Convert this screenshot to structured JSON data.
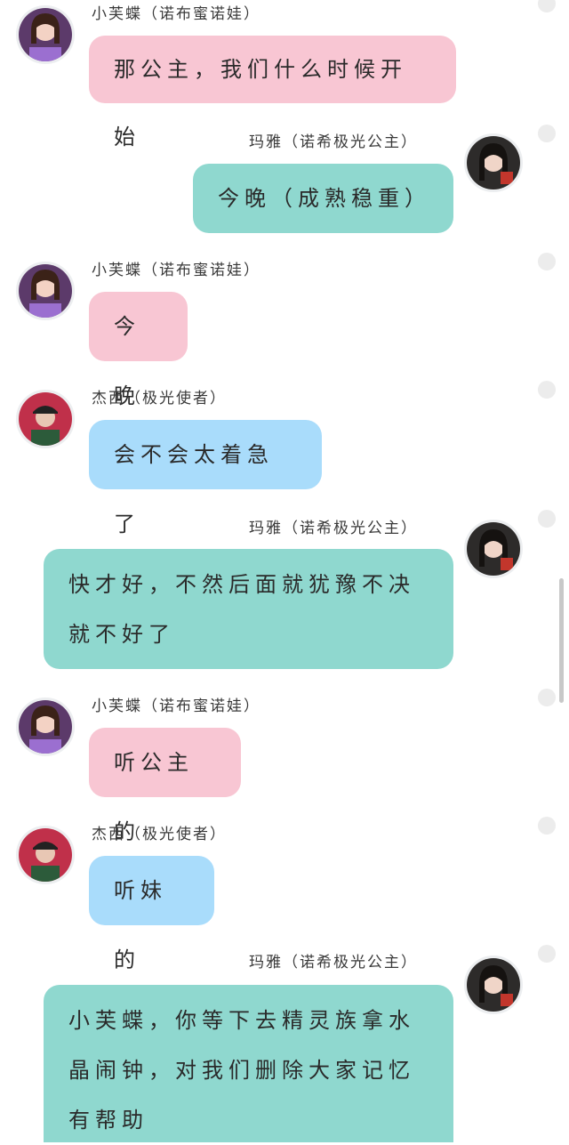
{
  "messages": [
    {
      "sender": "小芙蝶（诺布蜜诺娃）",
      "text": "那公主，我们什么时候开始",
      "avatar": "girl-purple-avatar-icon"
    },
    {
      "sender": "玛雅（诺希极光公主）",
      "text": "今晚（成熟稳重）",
      "avatar": "girl-dark-hair-avatar-icon"
    },
    {
      "sender": "小芙蝶（诺布蜜诺娃）",
      "text": "今晚",
      "avatar": "girl-purple-avatar-icon"
    },
    {
      "sender": "杰西（极光使者）",
      "text": "会不会太着急了",
      "avatar": "boy-cap-avatar-icon"
    },
    {
      "sender": "玛雅（诺希极光公主）",
      "text": "快才好，不然后面就犹豫不决\n就不好了",
      "avatar": "girl-dark-hair-avatar-icon"
    },
    {
      "sender": "小芙蝶（诺布蜜诺娃）",
      "text": "听公主的",
      "avatar": "girl-purple-avatar-icon"
    },
    {
      "sender": "杰西（极光使者）",
      "text": "听妹的",
      "avatar": "boy-cap-avatar-icon"
    },
    {
      "sender": "玛雅（诺希极光公主）",
      "text": "小芙蝶，你等下去精灵族拿水\n晶闹钟，对我们删除大家记忆\n有帮助",
      "avatar": "girl-dark-hair-avatar-icon"
    }
  ],
  "colors": {
    "pink_bubble": "#f8c6d3",
    "teal_bubble": "#8fd8cf",
    "blue_bubble": "#a9dcfb"
  }
}
